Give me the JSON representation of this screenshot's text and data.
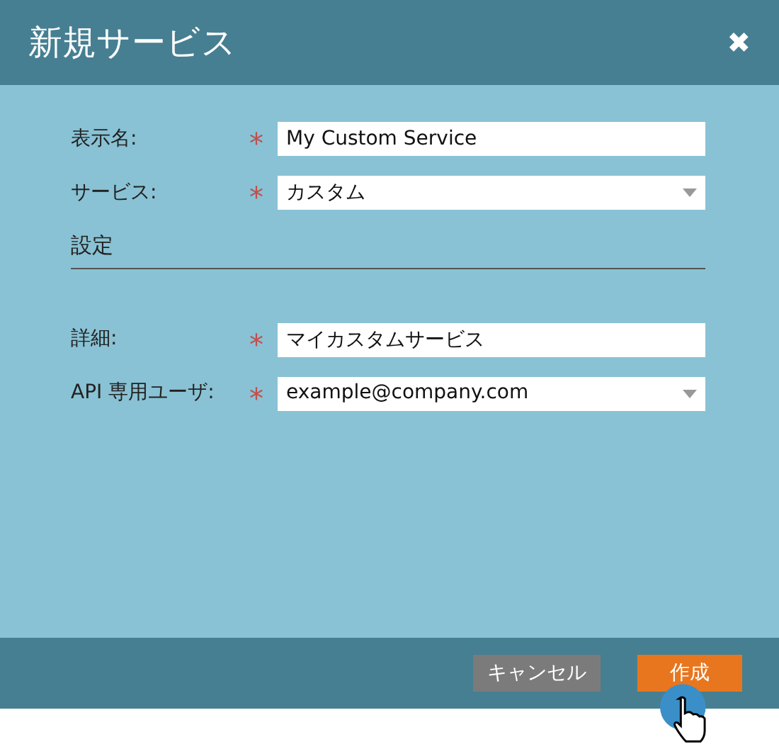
{
  "dialog": {
    "title": "新規サービス",
    "close": "✖"
  },
  "fields": [
    {
      "label": "表示名:",
      "required_mark": "*",
      "kind": "text",
      "value": "My Custom Service"
    },
    {
      "label": "サービス:",
      "required_mark": "*",
      "kind": "select",
      "value": "カスタム"
    }
  ],
  "section": {
    "title": "設定"
  },
  "settings_fields": [
    {
      "label": "詳細:",
      "required_mark": "*",
      "kind": "text",
      "value": "マイカスタムサービス"
    },
    {
      "label": "API 専用ユーザ:",
      "required_mark": "*",
      "kind": "select",
      "value": "example@company.com"
    }
  ],
  "buttons": [
    {
      "label": "キャンセル",
      "kind": "secondary"
    },
    {
      "label": "作成",
      "kind": "primary"
    }
  ]
}
